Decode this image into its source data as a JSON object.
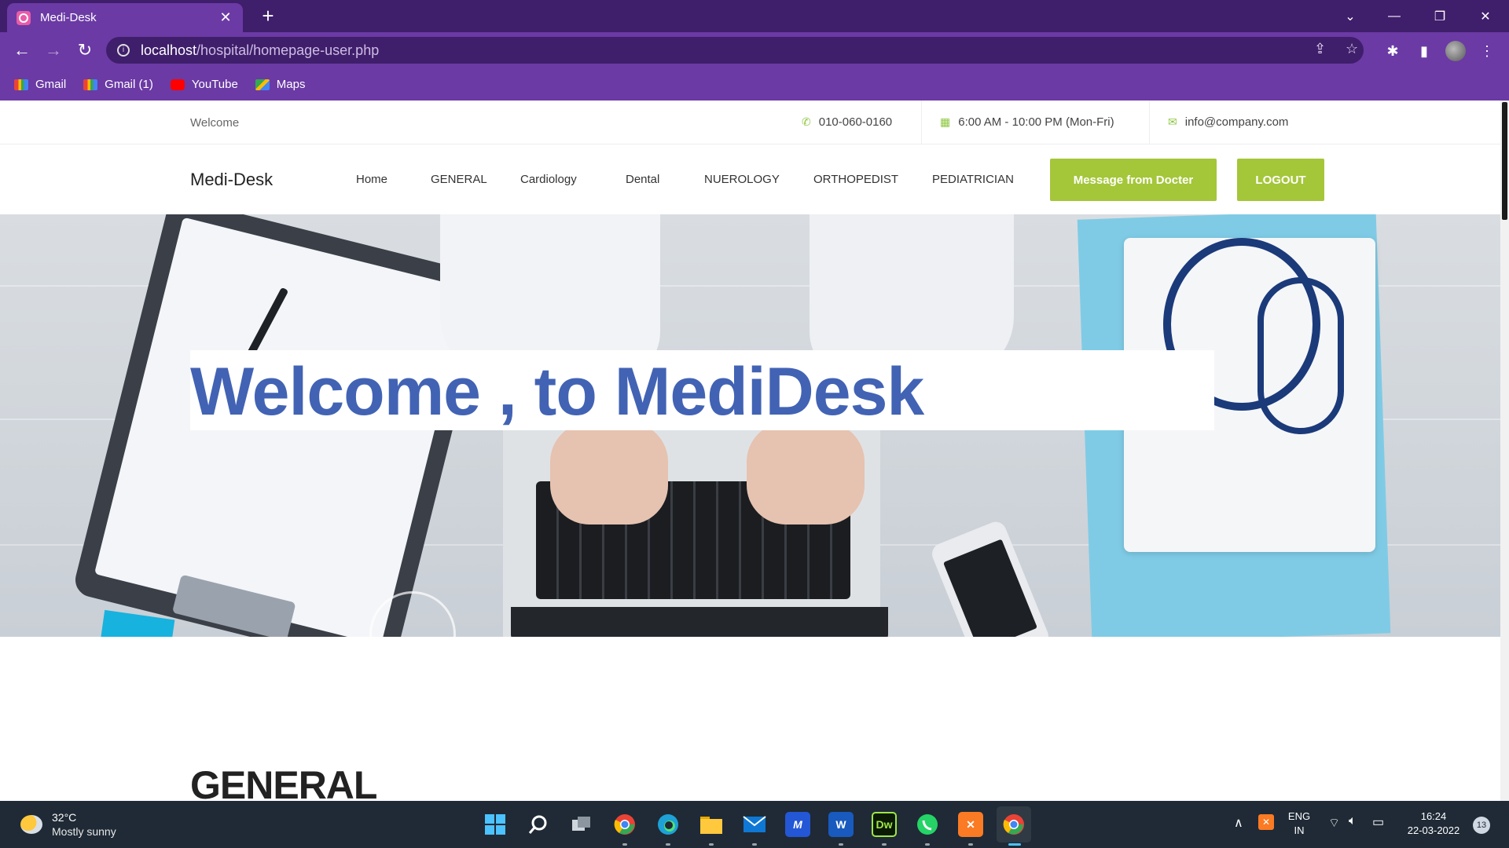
{
  "browser": {
    "tab_title": "Medi-Desk",
    "url_host": "localhost",
    "url_path": "/hospital/homepage-user.php",
    "bookmarks": [
      {
        "label": "Gmail",
        "icon": "gmail-icon"
      },
      {
        "label": "Gmail (1)",
        "icon": "gmail-icon"
      },
      {
        "label": "YouTube",
        "icon": "youtube-icon"
      },
      {
        "label": "Maps",
        "icon": "maps-icon"
      }
    ]
  },
  "topbar": {
    "welcome": "Welcome",
    "phone": "010-060-0160",
    "hours": "6:00 AM - 10:00 PM (Mon-Fri)",
    "email": "info@company.com"
  },
  "nav": {
    "brand": "Medi-Desk",
    "links": [
      "Home",
      "GENERAL",
      "Cardiology",
      "Dental",
      "NUEROLOGY",
      "ORTHOPEDIST",
      "PEDIATRICIAN"
    ],
    "message_button": "Message from Docter",
    "logout_button": "LOGOUT"
  },
  "hero": {
    "title": "Welcome , to MediDesk"
  },
  "sections": {
    "general_title": "GENERAL"
  },
  "taskbar": {
    "temperature": "32°C",
    "weather": "Mostly sunny",
    "language": "ENG",
    "region": "IN",
    "time": "16:24",
    "date": "22-03-2022",
    "notifications": "13"
  },
  "colors": {
    "accent_green": "#a4c639",
    "hero_title_blue": "#4263b4",
    "chrome_purple": "#6b3aa5"
  }
}
